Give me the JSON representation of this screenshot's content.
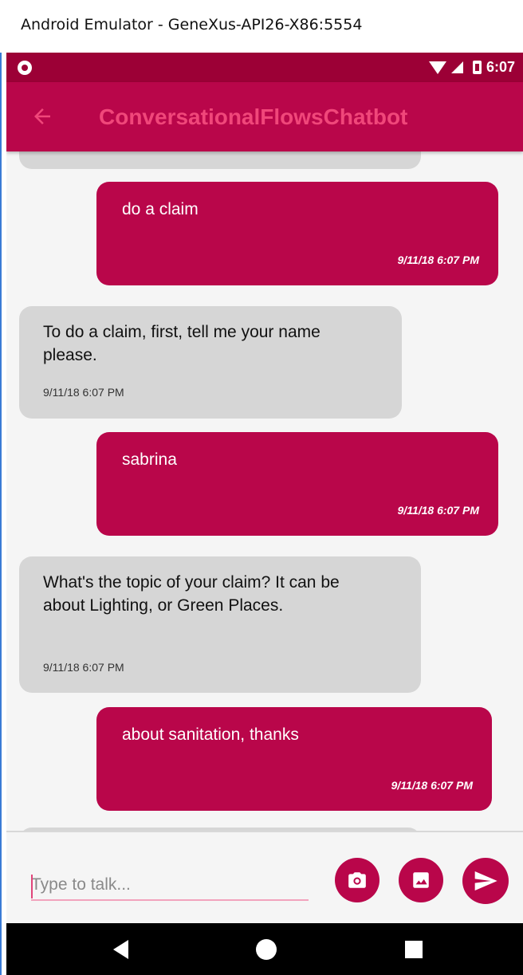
{
  "window": {
    "title": "Android Emulator - GeneXus-API26-X86:5554"
  },
  "status_bar": {
    "time": "6:07",
    "icons": [
      "notification-dot-icon",
      "wifi-icon",
      "signal-icon",
      "battery-icon"
    ]
  },
  "app_bar": {
    "title": "ConversationalFlowsChatbot",
    "back_icon": "arrow-left-icon"
  },
  "messages": [
    {
      "from": "user",
      "text": "do a claim",
      "time": "9/11/18 6:07 PM"
    },
    {
      "from": "bot",
      "text": "To do a claim, first, tell me your name please.",
      "time": "9/11/18 6:07 PM"
    },
    {
      "from": "user",
      "text": "sabrina",
      "time": "9/11/18 6:07 PM"
    },
    {
      "from": "bot",
      "text": "What's the topic of your claim? It can be about Lighting, or Green Places.",
      "time": "9/11/18 6:07 PM"
    },
    {
      "from": "user",
      "text": "about sanitation, thanks",
      "time": "9/11/18 6:07 PM"
    }
  ],
  "composer": {
    "placeholder": "Type to talk...",
    "value": "",
    "buttons": [
      "camera-icon",
      "image-icon",
      "send-icon"
    ]
  },
  "nav_bar": {
    "buttons": [
      "back-triangle-icon",
      "home-circle-icon",
      "recents-square-icon"
    ]
  },
  "colors": {
    "primary": "#b9064a",
    "primary_dark": "#9c0036",
    "title_text": "#f0477a",
    "bot_bubble": "#d6d6d6",
    "background": "#f5f5f5"
  }
}
